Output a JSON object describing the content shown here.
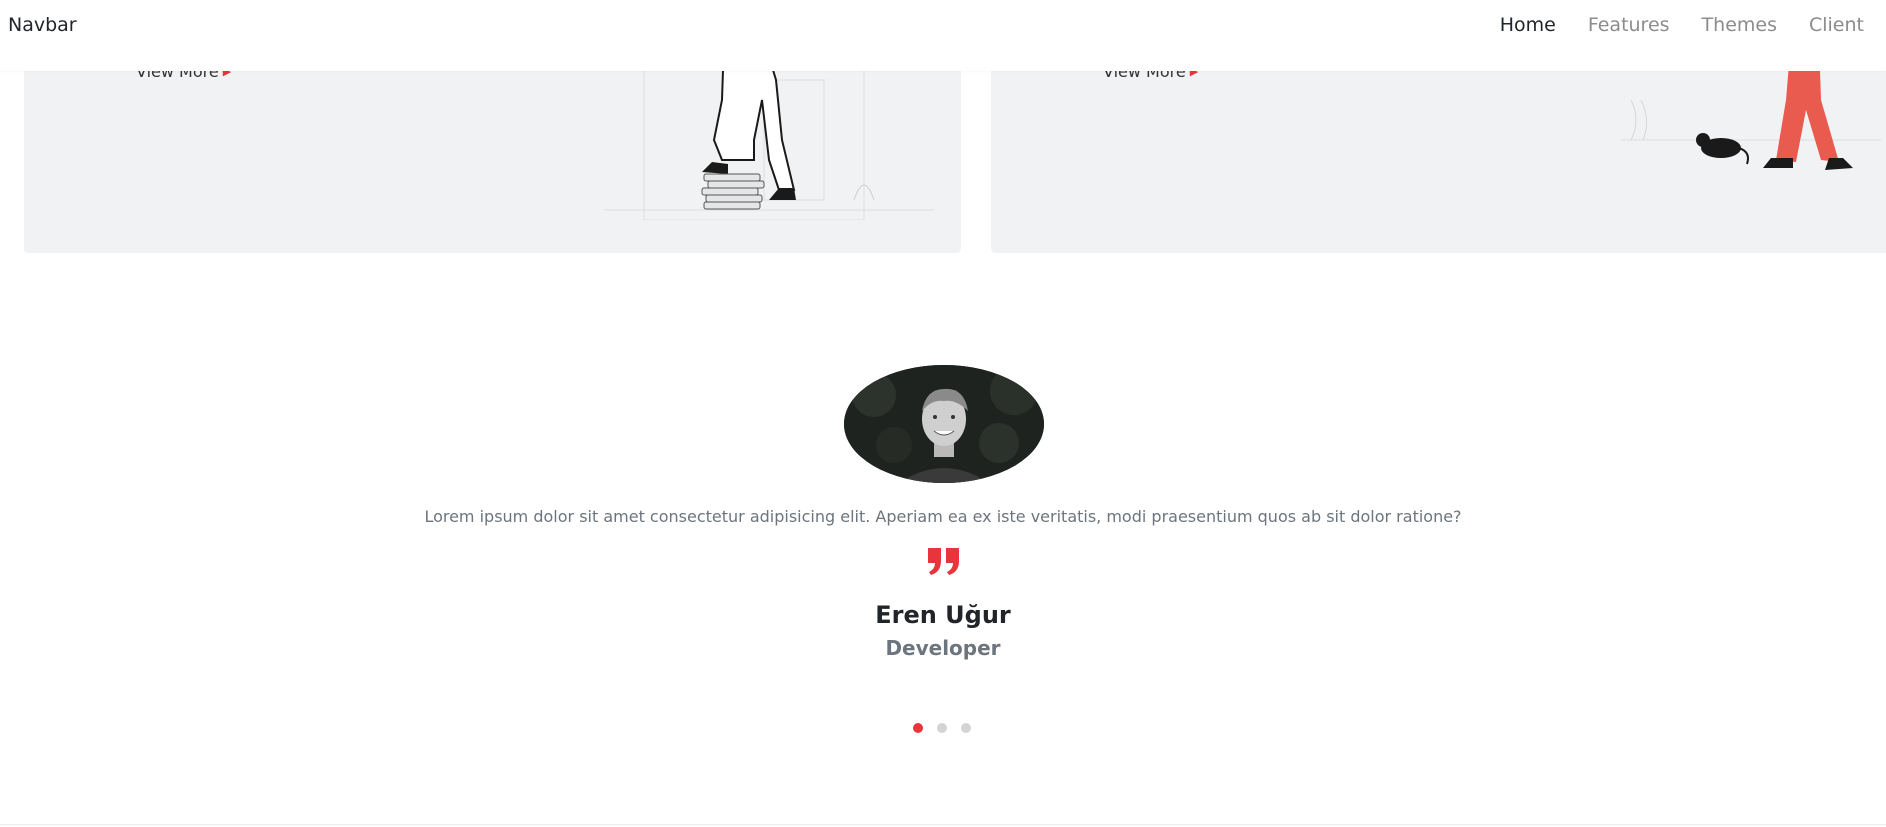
{
  "navbar": {
    "brand": "Navbar",
    "links": [
      {
        "label": "Home",
        "active": true
      },
      {
        "label": "Features",
        "active": false
      },
      {
        "label": "Themes",
        "active": false
      },
      {
        "label": "Client",
        "active": false
      }
    ]
  },
  "cards": [
    {
      "view_more": "View More"
    },
    {
      "view_more": "View More"
    }
  ],
  "testimonial": {
    "quote": "Lorem ipsum dolor sit amet consectetur adipisicing elit. Aperiam ea ex iste veritatis, modi praesentium quos ab sit dolor ratione?",
    "name": "Eren Uğur",
    "role": "Developer",
    "slides": 3,
    "active_slide": 1
  },
  "colors": {
    "accent": "#e8343a",
    "card_bg": "#f1f2f4",
    "muted": "#6c757d",
    "nav_inactive": "#8c8c8c"
  }
}
